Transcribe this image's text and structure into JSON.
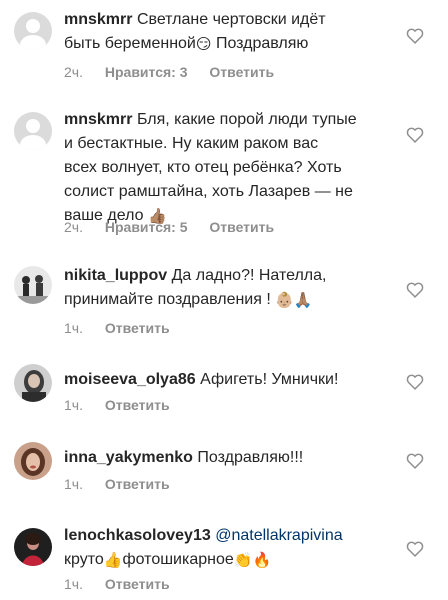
{
  "comments": [
    {
      "user": "mnskmrr",
      "lines": [
        "Светлане чертовски идёт",
        "быть беременной"
      ],
      "line2_tail": " Поздравляю",
      "emoji": "😏",
      "time": "2ч.",
      "likes": "Нравится: 3",
      "reply": "Ответить"
    },
    {
      "user": "mnskmrr",
      "lines": [
        "Бля, какие порой люди тупые",
        "и бестактные. Ну каким раком вас",
        "всех волнует, кто отец ребёнка? Хоть",
        "солист рамштайна, хоть Лазарев — не",
        "ваше дело"
      ],
      "emoji": "👍🏽",
      "time": "2ч.",
      "likes": "Нравится: 5",
      "reply": "Ответить"
    },
    {
      "user": "nikita_luppov",
      "lines": [
        "Да ладно?! Нателла,",
        "принимайте поздравления !"
      ],
      "emoji": "👶🏼🙏🏽",
      "time": "1ч.",
      "reply": "Ответить"
    },
    {
      "user": "moiseeva_olya86",
      "lines": [
        "Афигеть! Умнички!"
      ],
      "time": "1ч.",
      "reply": "Ответить"
    },
    {
      "user": "inna_yakymenko",
      "lines": [
        "Поздравляю!!!"
      ],
      "time": "1ч.",
      "reply": "Ответить"
    },
    {
      "user": "lenochkasolovey13",
      "mention": "@natellakrapivina",
      "lines": [
        "круто",
        "фотошикарное"
      ],
      "emoji1": "👍",
      "emoji2": "👏🔥",
      "time": "1ч.",
      "reply": "Ответить"
    }
  ],
  "colors": {
    "text": "#262626",
    "meta": "#8e8e8e",
    "mention": "#003569",
    "avatar_placeholder": "#dbdbdb"
  },
  "icons": {
    "like": "heart-outline-icon",
    "avatar_placeholder": "default-user-icon"
  }
}
